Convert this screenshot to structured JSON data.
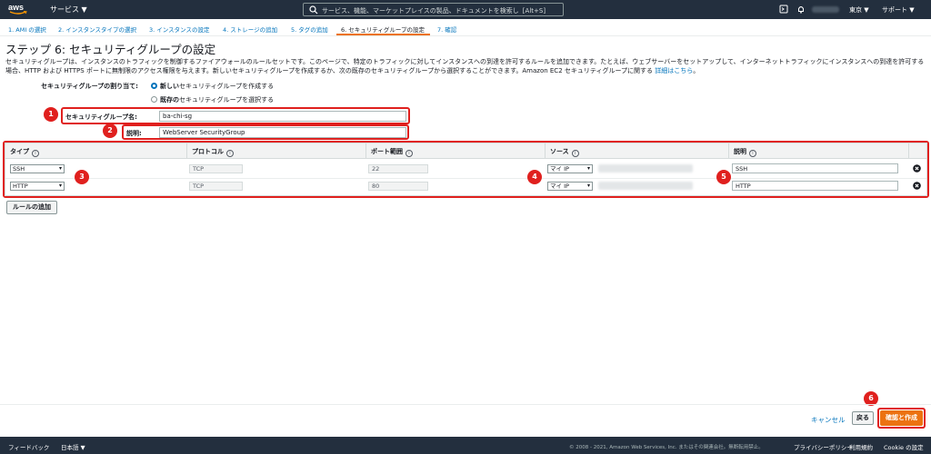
{
  "topnav": {
    "logo": "aws",
    "services_label": "サービス ▼",
    "search_placeholder": "サービス、機能、マーケットプレイスの製品、ドキュメントを検索し",
    "search_shortcut": "[Alt+S]",
    "region": "東京 ▼",
    "support": "サポート ▼",
    "icons": [
      "cloudshell-icon",
      "bell-icon"
    ]
  },
  "wizard": {
    "steps": [
      "1. AMI の選択",
      "2. インスタンスタイプの選択",
      "3. インスタンスの設定",
      "4. ストレージの追加",
      "5. タグの追加",
      "6. セキュリティグループの設定",
      "7. 確認"
    ],
    "active_step": 6
  },
  "page": {
    "title": "ステップ 6: セキュリティグループの設定",
    "description": "セキュリティグループは、インスタンスのトラフィックを制御するファイアウォールのルールセットです。このページで、特定のトラフィックに対してインスタンスへの到達を許可するルールを追加できます。たとえば、ウェブサーバーをセットアップして、インターネットトラフィックにインスタンスへの到達を許可する場合、HTTP および HTTPS ポートに無制限のアクセス権限を与えます。新しいセキュリティグループを作成するか、次の既存のセキュリティグループから選択することができます。Amazon EC2 セキュリティグループに関する",
    "learn_more": "詳細はこちら",
    "learn_more_suffix": "。"
  },
  "assignment": {
    "label": "セキュリティグループの割り当て:",
    "option_new_bold": "新しい",
    "option_new_rest": "セキュリティグループを作成する",
    "option_existing_bold": "既存の",
    "option_existing_rest": "セキュリティグループを選択する",
    "selected": "new"
  },
  "form": {
    "name_label": "セキュリティグループ名:",
    "name_value": "ba-chi-sg",
    "desc_label": "説明:",
    "desc_value": "WebServer SecurityGroup"
  },
  "table": {
    "headers": [
      "タイプ",
      "プロトコル",
      "ポート範囲",
      "ソース",
      "説明"
    ],
    "info_glyph": "i",
    "rows": [
      {
        "type": "SSH",
        "protocol": "TCP",
        "port": "22",
        "source": "マイ IP",
        "description": "SSH"
      },
      {
        "type": "HTTP",
        "protocol": "TCP",
        "port": "80",
        "source": "マイ IP",
        "description": "HTTP"
      }
    ]
  },
  "buttons": {
    "add_rule": "ルールの追加",
    "cancel": "キャンセル",
    "back": "戻る",
    "review_launch": "確認と作成"
  },
  "annotations": [
    "1",
    "2",
    "3",
    "4",
    "5",
    "6"
  ],
  "footer": {
    "feedback": "フィードバック",
    "language": "日本語 ▼",
    "copyright": "© 2008 - 2021, Amazon Web Services, Inc. またはその関連会社。無断転用禁止。",
    "privacy": "プライバシーポリシー",
    "terms": "利用規約",
    "cookie": "Cookie の設定"
  },
  "colors": {
    "nav_bg": "#232f3e",
    "primary": "#ec7211",
    "link": "#0073bb",
    "annotation_red": "#e0201e"
  }
}
